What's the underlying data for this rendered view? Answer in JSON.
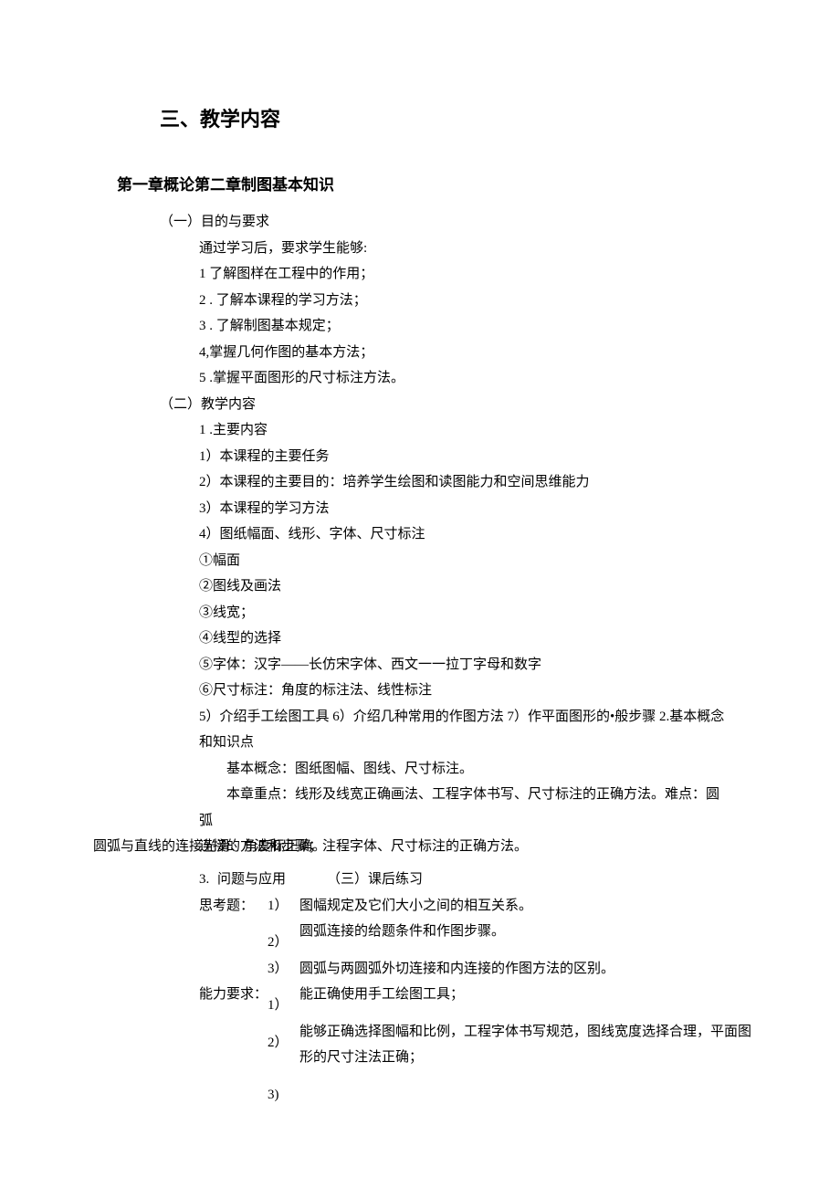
{
  "title": "三、教学内容",
  "chapter": "第一章概论第二章制图基本知识",
  "s1": {
    "head": "（一）目的与要求",
    "intro": "通过学习后，要求学生能够:",
    "items": [
      "1 了解图样在工程中的作用；",
      "2  . 了解本课程的学习方法；",
      "3  . 了解制图基本规定；",
      "4,掌握几何作图的基本方法；",
      "5  .掌握平面图形的尺寸标注方法。"
    ]
  },
  "s2": {
    "head": "（二）教学内容",
    "main_head": "1  .主要内容",
    "pts": [
      "1）本课程的主要任务",
      "2）本课程的主要目的：培养学生绘图和读图能力和空间思维能力",
      "3）本课程的学习方法",
      "4）图纸幅面、线形、字体、尺寸标注",
      "①幅面",
      "②图线及画法",
      "③线宽；",
      "④线型的选择",
      "⑤字体：汉字——长仿宋字体、西文一一拉丁字母和数字",
      "⑥尺寸标注：角度的标注法、线性标注",
      "5）介绍手工绘图工具 6）介绍几种常用的作图方法 7）作平面图形的•般步骤 2.基本概念和知识点"
    ],
    "concept": "基本概念：图纸图幅、图线、尺寸标注。",
    "focus": "本章重点：线形及线宽正确画法、工程字体书写、尺寸标注的正确方法。难点：圆弧",
    "over_front": "连接的方法和步骤；注程字体、尺寸标注的正确方法。",
    "over_back": "圆弧与直线的连接光滑、角度标正确。",
    "row_num": "3.",
    "row_a": "问题与应用",
    "row_b": "（三）课后练习",
    "think_lbl": "思考题：",
    "think": [
      {
        "n": "1）",
        "t": "图幅规定及它们大小之间的相互关系。"
      },
      {
        "n": "2）",
        "t": "圆弧连接的给题条件和作图步骤。"
      },
      {
        "n": "3）",
        "t": "圆弧与两圆弧外切连接和内连接的作图方法的区别。"
      }
    ],
    "ability_lbl": "能力要求：",
    "ability": [
      {
        "n": "1）",
        "t": "能正确使用手工绘图工具；"
      },
      {
        "n": "2）",
        "t": "能够正确选择图幅和比例，工程字体书写规范，图线宽度选择合理，平面图形的尺寸注法正确；"
      },
      {
        "n": "3)",
        "t": ""
      }
    ]
  }
}
